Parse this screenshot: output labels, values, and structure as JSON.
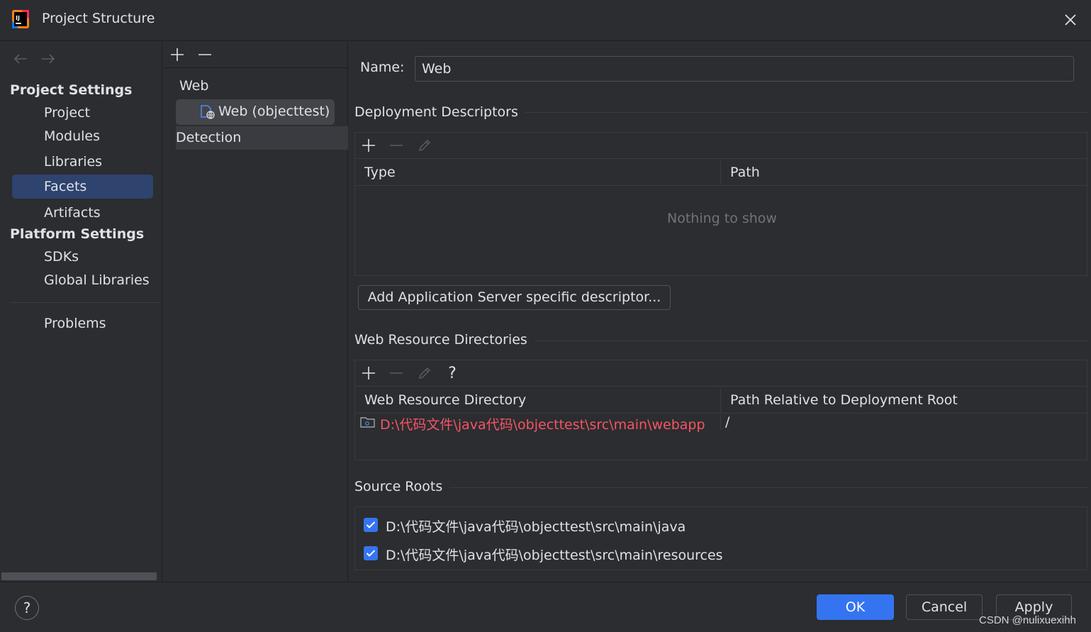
{
  "window": {
    "title": "Project Structure"
  },
  "sidebar": {
    "project_settings_header": "Project Settings",
    "project_items": [
      "Project",
      "Modules",
      "Libraries",
      "Facets",
      "Artifacts"
    ],
    "selected_item": "Facets",
    "platform_settings_header": "Platform Settings",
    "platform_items": [
      "SDKs",
      "Global Libraries"
    ],
    "problems": "Problems"
  },
  "middle": {
    "tree_root": "Web",
    "facet_item": "Web (objecttest)",
    "detection": "Detection"
  },
  "right": {
    "name_label": "Name:",
    "name_value": "Web",
    "deployment": {
      "title": "Deployment Descriptors",
      "columns": [
        "Type",
        "Path"
      ],
      "empty_text": "Nothing to show",
      "add_button": "Add Application Server specific descriptor..."
    },
    "web_resources": {
      "title": "Web Resource Directories",
      "help_glyph": "?",
      "columns": [
        "Web Resource Directory",
        "Path Relative to Deployment Root"
      ],
      "rows": [
        {
          "directory": "D:\\代码文件\\java代码\\objecttest\\src\\main\\webapp",
          "relative_path": "/"
        }
      ]
    },
    "source_roots": {
      "title": "Source Roots",
      "items": [
        {
          "path": "D:\\代码文件\\java代码\\objecttest\\src\\main\\java",
          "checked": true
        },
        {
          "path": "D:\\代码文件\\java代码\\objecttest\\src\\main\\resources",
          "checked": true
        }
      ]
    }
  },
  "footer": {
    "help_glyph": "?",
    "ok": "OK",
    "cancel": "Cancel",
    "apply": "Apply",
    "watermark": "CSDN @nulixuexihh"
  },
  "colors": {
    "background": "#2b2d30",
    "selection": "#2e436e",
    "accent": "#3574f0",
    "error_path": "#f75464",
    "muted": "#6f737a"
  },
  "icons": [
    "app-logo-icon",
    "close-icon",
    "back-arrow-icon",
    "forward-arrow-icon",
    "add-icon",
    "remove-icon",
    "edit-icon",
    "web-facet-icon",
    "folder-icon",
    "checkbox-checked-icon",
    "help-icon"
  ]
}
